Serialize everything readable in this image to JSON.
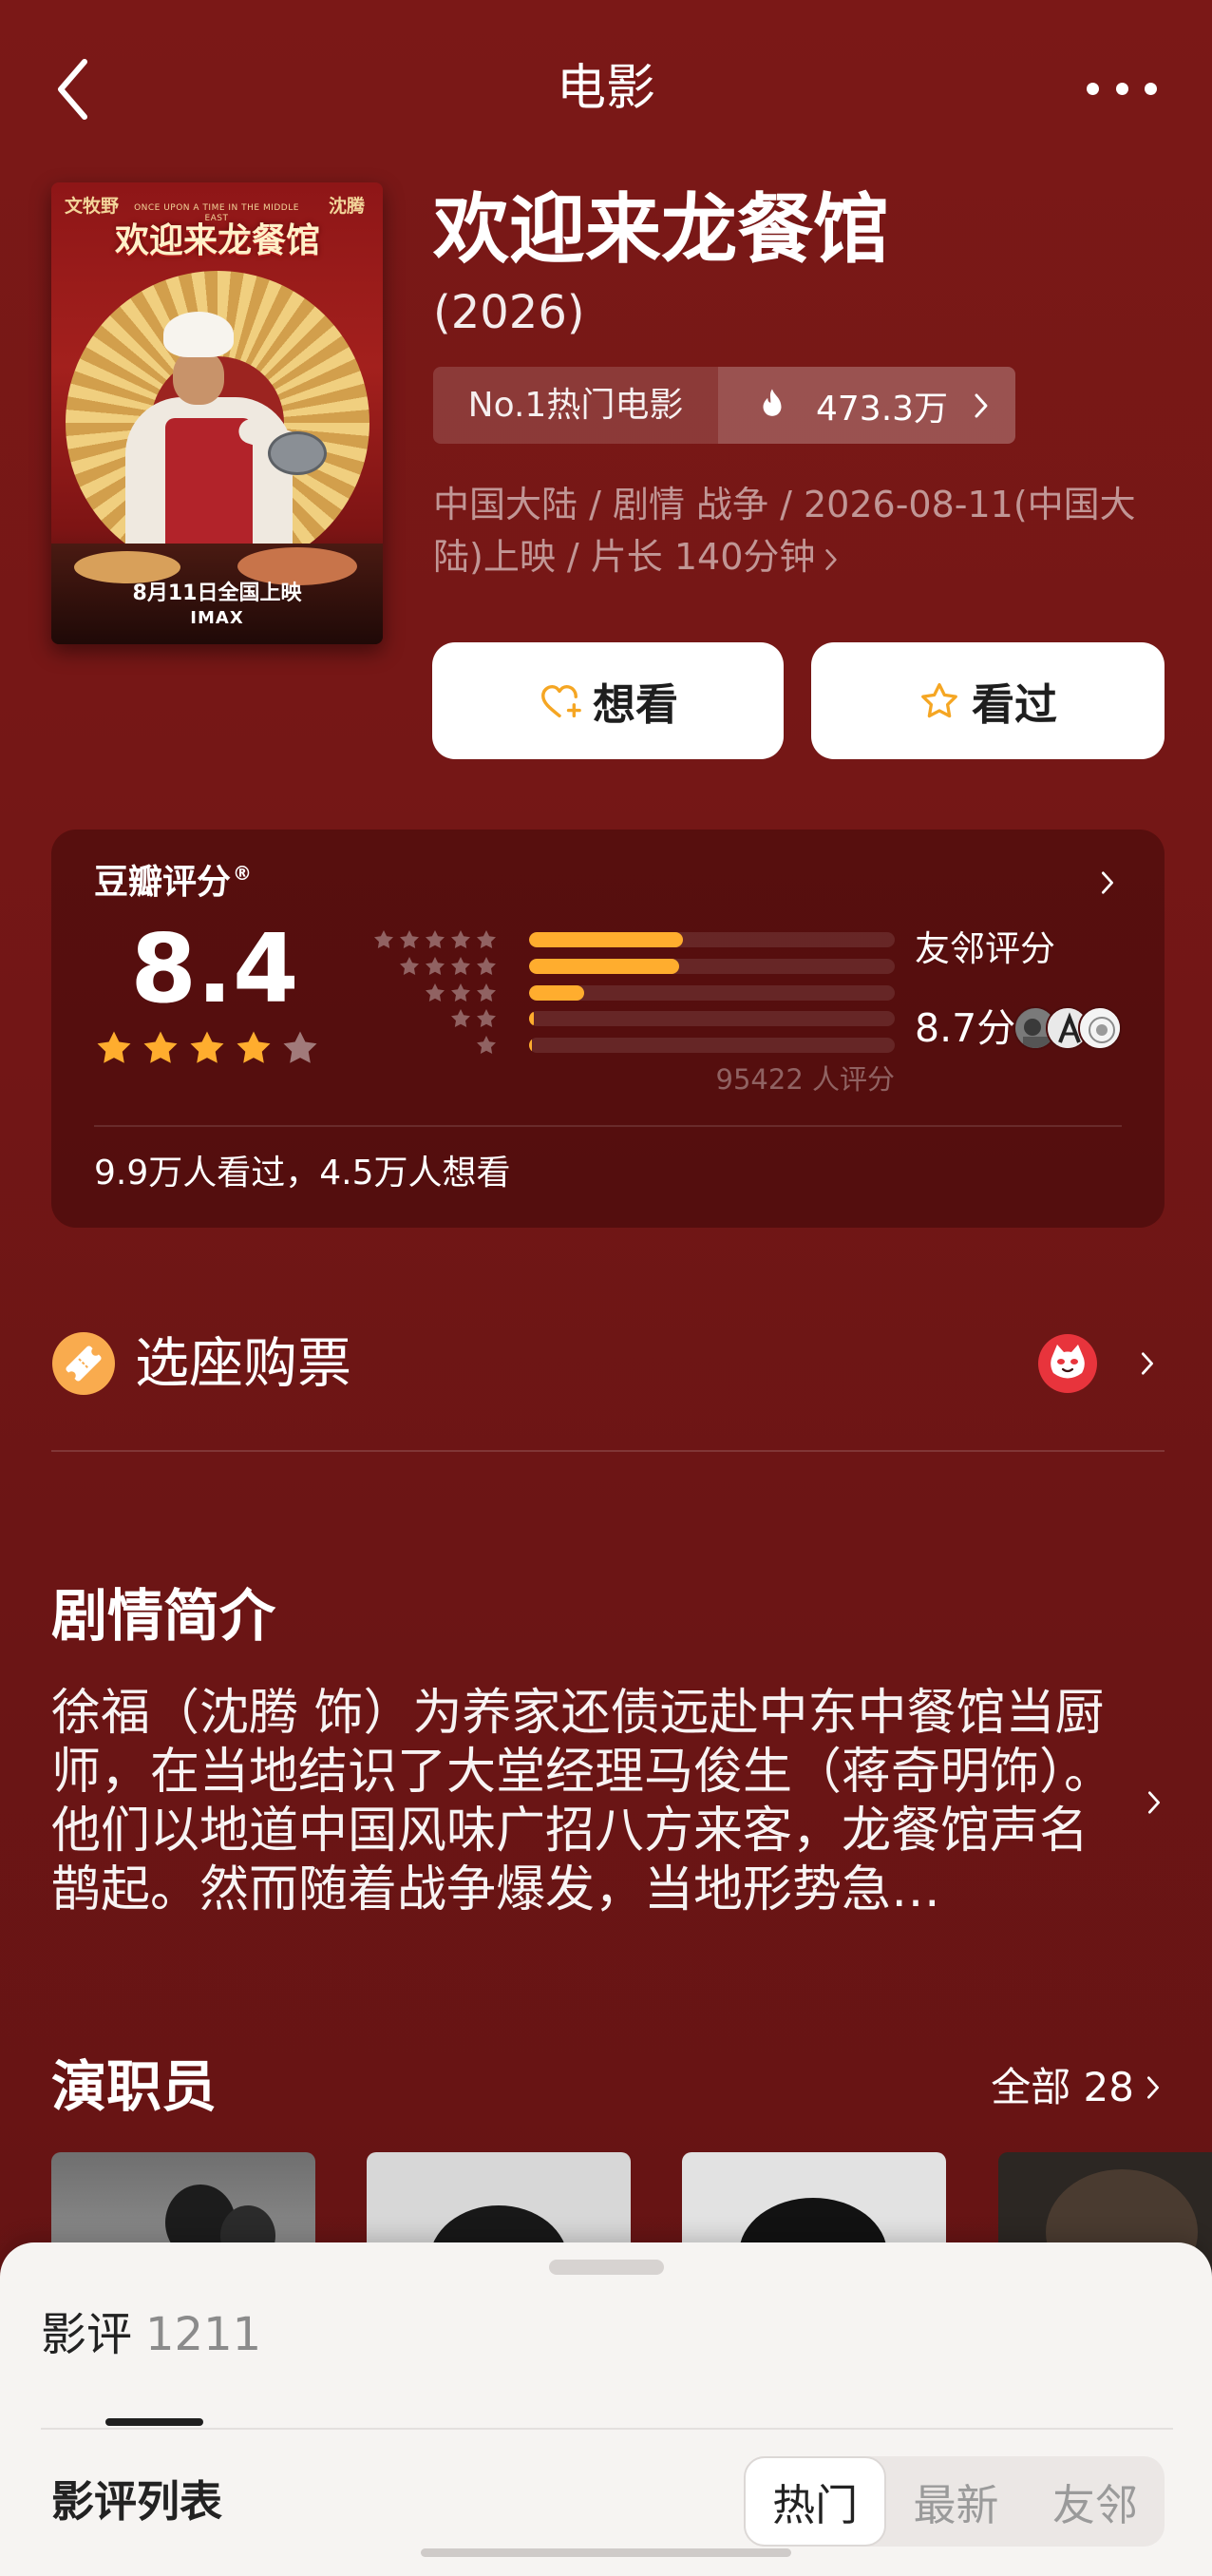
{
  "nav": {
    "title": "电影",
    "back_icon": "chevron-left-icon",
    "more_icon": "more-dots-icon"
  },
  "poster": {
    "director": "文牧野",
    "star": "沈腾",
    "english_title": "ONCE UPON A TIME IN THE MIDDLE EAST",
    "title": "欢迎来龙餐馆",
    "release": "8月11日全国上映",
    "format": "IMAX"
  },
  "movie": {
    "title": "欢迎来龙餐馆",
    "year": "(2026)",
    "rank_badge": "No.1热门电影",
    "heat": "473.3万",
    "meta": "中国大陆 / 剧情 战争 / 2026-08-11(中国大陆)上映 / 片长 140分钟"
  },
  "actions": {
    "want": "想看",
    "want_icon": "heart-plus-icon",
    "seen": "看过",
    "seen_icon": "star-outline-icon"
  },
  "rating": {
    "label": "豆瓣评分",
    "mark": "®",
    "score": "8.4",
    "stars_filled": 4,
    "stars_total": 5,
    "distribution": [
      {
        "stars": 5,
        "fraction": 0.42
      },
      {
        "stars": 4,
        "fraction": 0.41
      },
      {
        "stars": 3,
        "fraction": 0.15
      },
      {
        "stars": 2,
        "fraction": 0.013
      },
      {
        "stars": 1,
        "fraction": 0.005
      }
    ],
    "count_text": "95422 人评分",
    "friends_label": "友邻评分",
    "friends_score": "8.7分",
    "summary": "9.9万人看过，4.5万人想看"
  },
  "tickets": {
    "label": "选座购票",
    "icon": "ticket-icon",
    "provider_icon": "maoyan-cat-logo-icon"
  },
  "synopsis": {
    "heading": "剧情简介",
    "text": "徐福（沈腾 饰）为养家还债远赴中东中餐馆当厨师，在当地结识了大堂经理马俊生（蒋奇明饰）。他们以地道中国风味广招八方来客，龙餐馆声名鹊起。然而随着战争爆发，当地形势急…"
  },
  "cast": {
    "heading": "演职员",
    "all_label": "全部 28"
  },
  "reviews": {
    "tab_label": "影评",
    "count": "1211",
    "list_label": "影评列表",
    "sort_tabs": [
      {
        "label": "热门",
        "selected": true
      },
      {
        "label": "最新",
        "selected": false
      },
      {
        "label": "友邻",
        "selected": false
      }
    ]
  },
  "colors": {
    "accent": "#ffad2e",
    "star_empty": "rgba(255,255,255,0.45)",
    "star_label": "rgba(255,255,255,0.35)",
    "background": "#731615"
  }
}
